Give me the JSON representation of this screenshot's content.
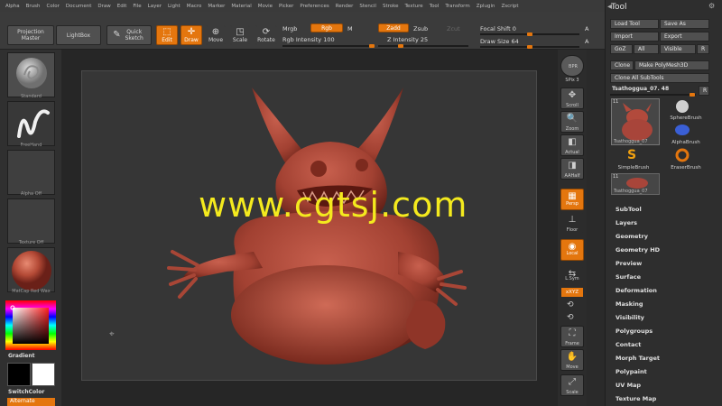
{
  "menu": [
    "Alpha",
    "Brush",
    "Color",
    "Document",
    "Draw",
    "Edit",
    "File",
    "Layer",
    "Light",
    "Macro",
    "Marker",
    "Material",
    "Movie",
    "Picker",
    "Preferences",
    "Render",
    "Stencil",
    "Stroke",
    "Texture",
    "Tool",
    "Transform",
    "Zplugin",
    "Zscript"
  ],
  "shelf": {
    "projection_master": "Projection Master",
    "lightbox": "LightBox",
    "quick_sketch": "Quick Sketch",
    "edit": "Edit",
    "draw": "Draw",
    "move": "Move",
    "scale": "Scale",
    "rotate": "Rotate",
    "mrgb": "Mrgb",
    "rgb": "Rgb",
    "m": "M",
    "rgb_intensity": "Rgb Intensity 100",
    "zadd": "Zadd",
    "zsub": "Zsub",
    "zcut": "Zcut",
    "z_intensity": "Z Intensity 25",
    "focal_shift": "Focal Shift 0",
    "draw_size": "Draw Size 64",
    "a1": "A",
    "a2": "A"
  },
  "left": {
    "standard": "Standard",
    "freehand": "FreeHand",
    "alpha_off": "Alpha Off",
    "texture_off": "Texture Off",
    "matcap": "MatCap Red Wax",
    "gradient": "Gradient",
    "switchcolor": "SwitchColor",
    "alternate": "Alternate"
  },
  "watermark": "www.cgtsj.com",
  "right_strip": {
    "bpr": "BPR",
    "spix": "SPix 3",
    "scroll": "Scroll",
    "zoom": "Zoom",
    "actual": "Actual",
    "aahalf": "AAHalf",
    "persp": "Persp",
    "floor": "Floor",
    "local": "Local",
    "lsym": "L.Sym",
    "xyz": "xXYZ",
    "frame": "Frame",
    "move": "Move",
    "scale": "Scale"
  },
  "tool": {
    "title": "Tool",
    "load_tool": "Load Tool",
    "save_as": "Save As",
    "import": "Import",
    "export": "Export",
    "goz": "GoZ",
    "all": "All",
    "visible": "Visible",
    "r": "R",
    "clone": "Clone",
    "make_polymesh": "Make PolyMesh3D",
    "clone_all": "Clone All SubTools",
    "current_tool": "Tsathoggua_07. 48",
    "r2": "R",
    "subtool_count1": "11",
    "subtool_count2": "11",
    "thumb1_label": "Tsathoggua_07",
    "thumb2_label": "Tsathoggua_07",
    "sphere_brush": "SphereBrush",
    "alpha_brush": "AlphaBrush",
    "simple_brush": "SimpleBrush",
    "eraser_brush": "EraserBrush",
    "sections": [
      "SubTool",
      "Layers",
      "Geometry",
      "Geometry HD",
      "Preview",
      "Surface",
      "Deformation",
      "Masking",
      "Visibility",
      "Polygroups",
      "Contact",
      "Morph Target",
      "Polypaint",
      "UV Map",
      "Texture Map"
    ]
  },
  "colors": {
    "accent": "#e4760e",
    "model": "#b24a3c",
    "watermark": "#f4ea1e"
  }
}
